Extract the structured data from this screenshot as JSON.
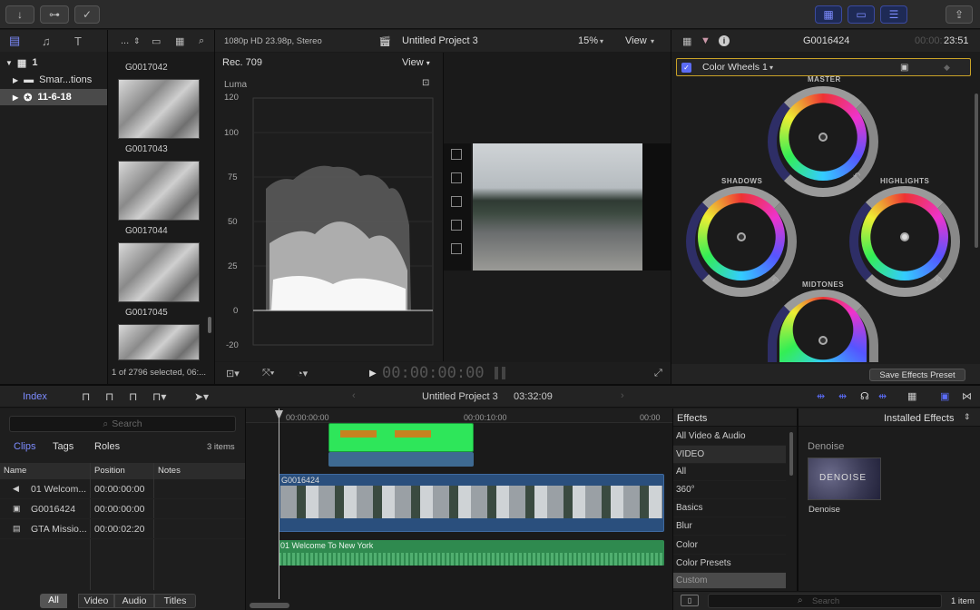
{
  "toolbar": {
    "import_icon": "download-icon",
    "keywords_icon": "key-icon",
    "analysis_icon": "checkmark-circle-icon",
    "share_icon": "share-icon"
  },
  "library": {
    "items": [
      {
        "label": "1"
      },
      {
        "label": "Smar...tions"
      },
      {
        "label": "11-6-18"
      }
    ]
  },
  "browser": {
    "header_label": "...",
    "clips": [
      "G0017042",
      "G0017043",
      "G0017044",
      "G0017045"
    ],
    "status": "1 of 2796 selected, 06:..."
  },
  "scope": {
    "title": "Rec. 709",
    "view_label": "View",
    "mode_label": "Luma",
    "y_ticks": [
      "120",
      "100",
      "75",
      "50",
      "25",
      "0",
      "-20"
    ]
  },
  "viewer": {
    "format": "1080p HD 23.98p, Stereo",
    "project_title": "Untitled Project 3",
    "zoom": "15%",
    "view_label": "View",
    "timecode": "00:00:00:00"
  },
  "inspector": {
    "clip_name": "G0016424",
    "timecode_dim": "00:00:",
    "timecode": "23:51",
    "effect_name": "Color Wheels 1",
    "wheels": [
      "MASTER",
      "SHADOWS",
      "HIGHLIGHTS",
      "MIDTONES"
    ],
    "save_button": "Save Effects Preset"
  },
  "timeline": {
    "index_label": "Index",
    "project_title": "Untitled Project 3",
    "duration": "03:32:09",
    "ruler": [
      "00:00:00:00",
      "00:00:10:00",
      "00:00"
    ],
    "clip_primary": "G0016424",
    "clip_audio": "01 Welcome To New York"
  },
  "index": {
    "search_placeholder": "Search",
    "tabs": [
      "Clips",
      "Tags",
      "Roles"
    ],
    "count": "3 items",
    "columns": [
      "Name",
      "Position",
      "Notes"
    ],
    "rows": [
      {
        "name": "01 Welcom...",
        "position": "00:00:00:00"
      },
      {
        "name": "G0016424",
        "position": "00:00:00:00"
      },
      {
        "name": "GTA Missio...",
        "position": "00:00:02:20"
      }
    ],
    "filters": [
      "All",
      "Video",
      "Audio",
      "Titles"
    ]
  },
  "effects": {
    "title": "Effects",
    "installed_label": "Installed Effects",
    "categories": [
      "All Video & Audio",
      "VIDEO",
      "All",
      "360°",
      "Basics",
      "Blur",
      "Color",
      "Color Presets",
      "Custom"
    ],
    "section": "Denoise",
    "item_label": "Denoise",
    "thumb_text": "DENOISE",
    "search_placeholder": "Search",
    "count": "1 item"
  },
  "colors": {
    "accent": "#5b6cf7",
    "selection_outline": "#c9a227",
    "primary_clip": "#2a4f7d",
    "audio_clip": "#2f8a4f",
    "title_clip": "#2ee65a"
  }
}
